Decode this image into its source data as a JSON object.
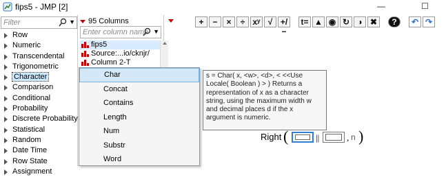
{
  "window": {
    "title": "fips5 - JMP [2]",
    "minimize_glyph": "—",
    "maximize_glyph": "☐"
  },
  "functions_panel": {
    "filter_placeholder": "Filter",
    "categories": [
      "Row",
      "Numeric",
      "Transcendental",
      "Trigonometric",
      "Character",
      "Comparison",
      "Conditional",
      "Probability",
      "Discrete Probability",
      "Statistical",
      "Random",
      "Date Time",
      "Row State",
      "Assignment"
    ],
    "selected_category": "Character"
  },
  "columns_panel": {
    "header": "95 Columns",
    "search_placeholder": "Enter column name",
    "columns": [
      "fips5",
      "Source:...io/cknjr/",
      "Column  2-T"
    ]
  },
  "popup_menu": {
    "items": [
      "Char",
      "Concat",
      "Contains",
      "Length",
      "Num",
      "Substr",
      "Word"
    ],
    "highlighted": "Char"
  },
  "toolbar": {
    "buttons": [
      {
        "name": "add",
        "glyph": "+"
      },
      {
        "name": "subtract",
        "glyph": "−"
      },
      {
        "name": "multiply",
        "glyph": "×"
      },
      {
        "name": "divide",
        "glyph": "÷"
      },
      {
        "name": "power",
        "glyph": "xʸ"
      },
      {
        "name": "root",
        "glyph": "√"
      },
      {
        "name": "change-sign",
        "glyph": "+/−"
      },
      {
        "name": "assign",
        "glyph": "t="
      },
      {
        "name": "up",
        "glyph": "▲"
      },
      {
        "name": "peel",
        "glyph": "◉"
      },
      {
        "name": "swap",
        "glyph": "↻"
      },
      {
        "name": "unary",
        "glyph": "◑"
      },
      {
        "name": "delete",
        "glyph": "✖"
      },
      {
        "name": "help",
        "glyph": "?"
      },
      {
        "name": "undo",
        "glyph": "↶"
      },
      {
        "name": "redo",
        "glyph": "↷"
      }
    ]
  },
  "tooltip": {
    "text": "s = Char( x, <w>, <d>, < <<Use Locale( Boolean ) > ) Returns a representation of x as a character string, using the maximum width w and decimal places d if the x argument is numeric."
  },
  "formula": {
    "function_name": "Right",
    "optional_arg": "n"
  },
  "colors": {
    "accent_red": "#c00000",
    "selection_blue": "#2d7fd3",
    "highlight_bg": "#d5e8fa"
  }
}
